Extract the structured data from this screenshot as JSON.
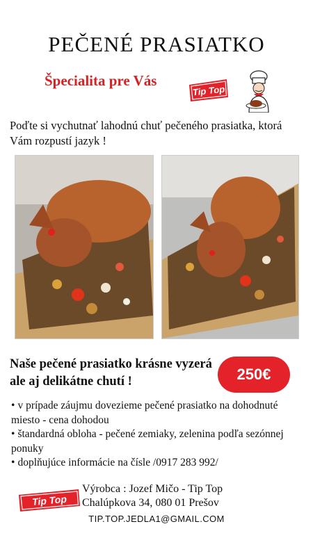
{
  "title": "PEČENÉ PRASIATKO",
  "tagline": "Špecialita pre Vás",
  "logo": {
    "text": "Tip Top",
    "color": "#e32229",
    "icon": "chef-icon"
  },
  "intro": "Poďte si vychutnať lahodnú chuť pečeného prasiatka, ktorá Vám rozpustí jazyk !",
  "photos": [
    {
      "icon": "roasted-pig-photo"
    },
    {
      "icon": "roasted-pig-photo"
    }
  ],
  "headline": "Naše pečené prasiatko krásne vyzerá ale aj delikátne chutí !",
  "price": {
    "label": "250€",
    "color": "#e32229"
  },
  "bullets": [
    "v prípade záujmu dovezieme pečené prasiatko na dohodnuté miesto - cena dohodou",
    "štandardná obloha - pečené zemiaky, zelenina podľa sezónnej ponuky",
    "doplňujúce informácie na čísle /0917 283 992/"
  ],
  "producer": {
    "line1": "Výrobca : Jozef Mičo - Tip Top",
    "line2": "Chalúpkova 34, 080 01 Prešov"
  },
  "email": "TIP.TOP.JEDLA1@GMAIL.COM"
}
